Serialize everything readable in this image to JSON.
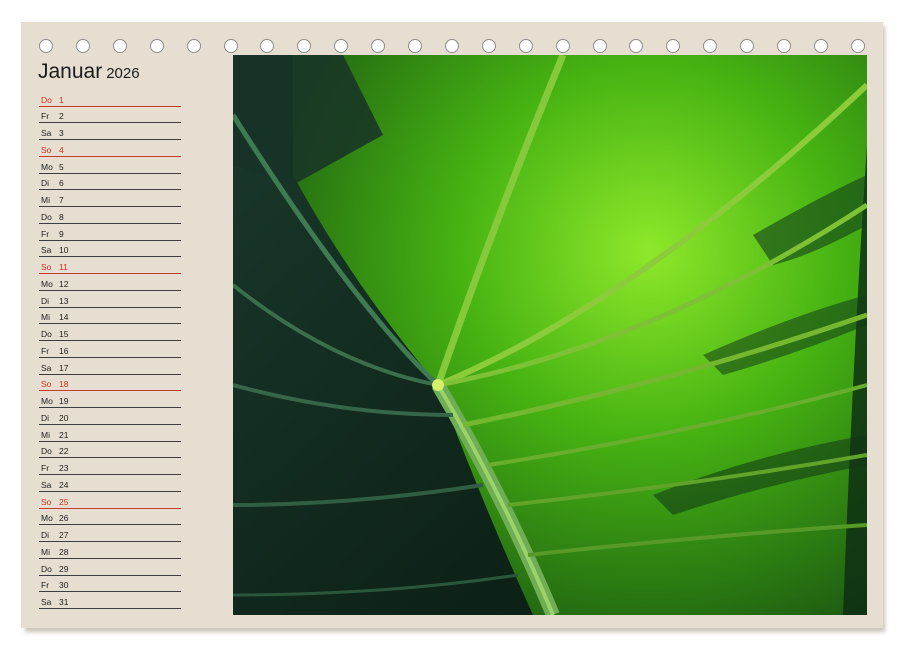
{
  "calendar": {
    "month": "Januar",
    "year": "2026",
    "days": [
      {
        "weekday": "Do",
        "day": "1",
        "sunday": true
      },
      {
        "weekday": "Fr",
        "day": "2",
        "sunday": false
      },
      {
        "weekday": "Sa",
        "day": "3",
        "sunday": false
      },
      {
        "weekday": "So",
        "day": "4",
        "sunday": true
      },
      {
        "weekday": "Mo",
        "day": "5",
        "sunday": false
      },
      {
        "weekday": "Di",
        "day": "6",
        "sunday": false
      },
      {
        "weekday": "Mi",
        "day": "7",
        "sunday": false
      },
      {
        "weekday": "Do",
        "day": "8",
        "sunday": false
      },
      {
        "weekday": "Fr",
        "day": "9",
        "sunday": false
      },
      {
        "weekday": "Sa",
        "day": "10",
        "sunday": false
      },
      {
        "weekday": "So",
        "day": "11",
        "sunday": true
      },
      {
        "weekday": "Mo",
        "day": "12",
        "sunday": false
      },
      {
        "weekday": "Di",
        "day": "13",
        "sunday": false
      },
      {
        "weekday": "Mi",
        "day": "14",
        "sunday": false
      },
      {
        "weekday": "Do",
        "day": "15",
        "sunday": false
      },
      {
        "weekday": "Fr",
        "day": "16",
        "sunday": false
      },
      {
        "weekday": "Sa",
        "day": "17",
        "sunday": false
      },
      {
        "weekday": "So",
        "day": "18",
        "sunday": true
      },
      {
        "weekday": "Mo",
        "day": "19",
        "sunday": false
      },
      {
        "weekday": "Di",
        "day": "20",
        "sunday": false
      },
      {
        "weekday": "Mi",
        "day": "21",
        "sunday": false
      },
      {
        "weekday": "Do",
        "day": "22",
        "sunday": false
      },
      {
        "weekday": "Fr",
        "day": "23",
        "sunday": false
      },
      {
        "weekday": "Sa",
        "day": "24",
        "sunday": false
      },
      {
        "weekday": "So",
        "day": "25",
        "sunday": true
      },
      {
        "weekday": "Mo",
        "day": "26",
        "sunday": false
      },
      {
        "weekday": "Di",
        "day": "27",
        "sunday": false
      },
      {
        "weekday": "Mi",
        "day": "28",
        "sunday": false
      },
      {
        "weekday": "Do",
        "day": "29",
        "sunday": false
      },
      {
        "weekday": "Fr",
        "day": "30",
        "sunday": false
      },
      {
        "weekday": "Sa",
        "day": "31",
        "sunday": false
      }
    ]
  },
  "photo": {
    "subject": "green-leaf-icon"
  },
  "colors": {
    "paper": "#e6dfd1",
    "sunday": "#d0301f",
    "leaf_bright": "#6fd21a",
    "leaf_dark": "#0e2a1a"
  }
}
